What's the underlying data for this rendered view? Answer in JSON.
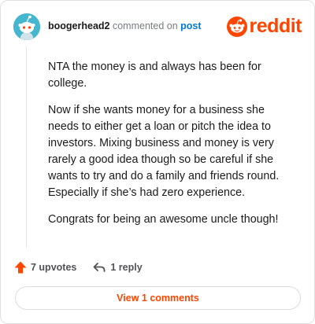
{
  "header": {
    "username": "boogerhead2",
    "action_text": "commented on",
    "post_link": "post",
    "logo_text": "reddit",
    "avatar_icon": "snoo-avatar",
    "brand_color": "#ff4500"
  },
  "comment": {
    "paragraphs": [
      "NTA the money is and always has been for college.",
      "Now if she wants money for a business she needs to either get a loan or pitch the idea to investors. Mixing business and money is very rarely a good idea though so be careful if she wants to try and do a family and friends round. Especially if she’s had zero experience.",
      "Congrats for being an awesome uncle though!"
    ]
  },
  "footer": {
    "upvotes": "7 upvotes",
    "replies": "1 reply",
    "upvote_icon": "upvote-arrow-icon",
    "reply_icon": "reply-arrow-icon"
  },
  "view_button": {
    "label": "View 1 comments"
  }
}
